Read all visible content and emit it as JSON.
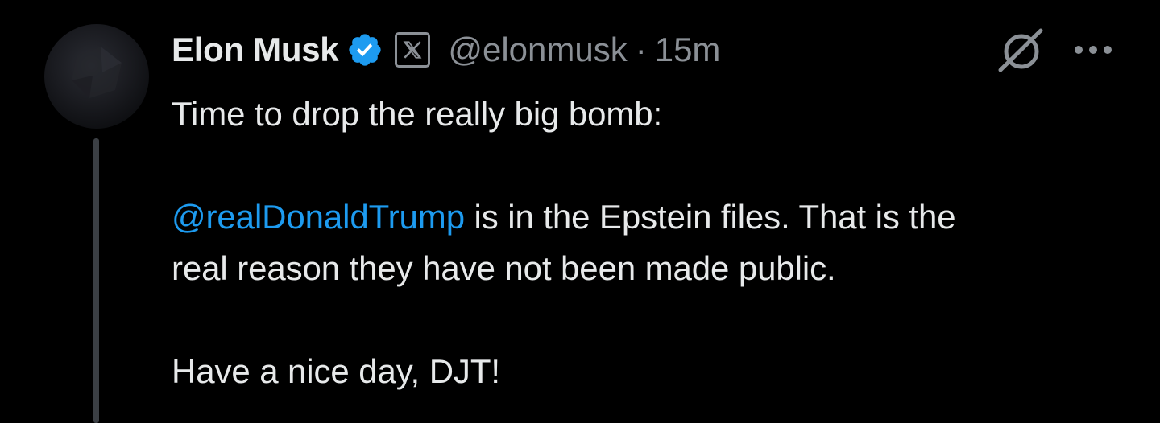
{
  "tweet": {
    "author": {
      "display_name": "Elon Musk",
      "handle": "@elonmusk",
      "verified": true
    },
    "separator": "·",
    "timestamp": "15m",
    "lines": {
      "line1": "Time to drop the really big bomb:",
      "mention": "@realDonaldTrump",
      "line2_rest": " is in the Epstein files. That is the",
      "line3": "real reason they have not been made public.",
      "line4": "Have a nice day, DJT!"
    }
  },
  "icons": {
    "verified": "verified-badge-icon",
    "x_logo": "x-logo-icon",
    "grok": "grok-icon",
    "more": "more-icon"
  },
  "colors": {
    "background": "#000000",
    "text": "#e7e9ea",
    "muted": "#8b9096",
    "accent": "#1d9bf0",
    "thread_line": "#3b3f44"
  }
}
